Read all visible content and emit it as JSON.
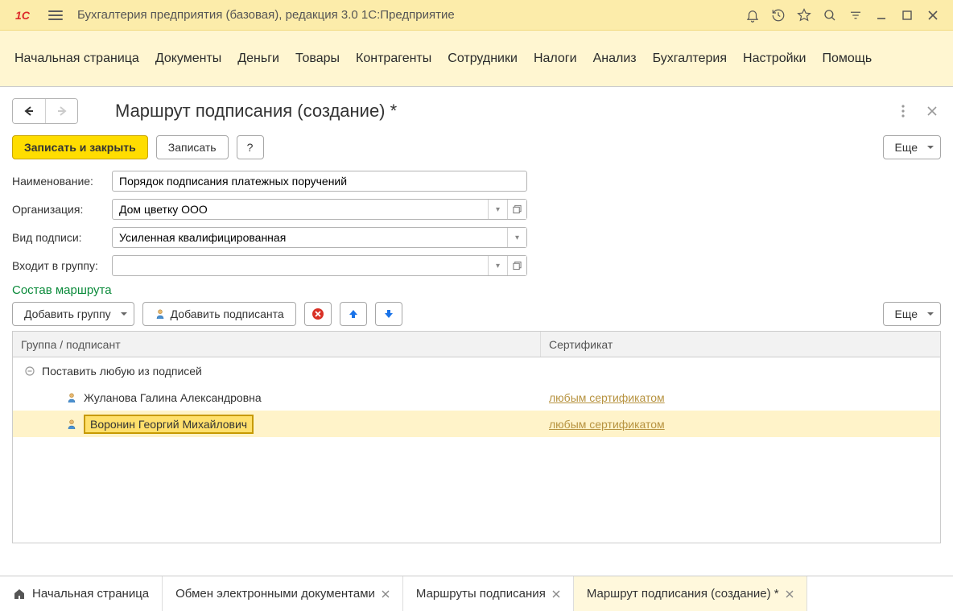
{
  "titlebar": {
    "title": "Бухгалтерия предприятия (базовая), редакция 3.0 1С:Предприятие"
  },
  "main_menu": [
    "Начальная страница",
    "Документы",
    "Деньги",
    "Товары",
    "Контрагенты",
    "Сотрудники",
    "Налоги",
    "Анализ",
    "Бухгалтерия",
    "Настройки",
    "Помощь"
  ],
  "page": {
    "title": "Маршрут подписания (создание) *"
  },
  "cmdbar": {
    "save_close": "Записать и закрыть",
    "save": "Записать",
    "help": "?",
    "more": "Еще"
  },
  "form": {
    "name_label": "Наименование:",
    "name_value": "Порядок подписания платежных поручений",
    "org_label": "Организация:",
    "org_value": "Дом цветку ООО",
    "sig_type_label": "Вид подписи:",
    "sig_type_value": "Усиленная квалифицированная",
    "group_label": "Входит в группу:",
    "group_value": ""
  },
  "route_section": {
    "title": "Состав маршрута",
    "add_group": "Добавить группу",
    "add_signer": "Добавить подписанта",
    "more": "Еще",
    "col_group": "Группа / подписант",
    "col_cert": "Сертификат",
    "rows": [
      {
        "type": "group",
        "text": "Поставить любую из подписей"
      },
      {
        "type": "signer",
        "text": "Жуланова Галина Александровна",
        "cert": "любым сертификатом",
        "selected": false
      },
      {
        "type": "signer",
        "text": "Воронин Георгий Михайлович",
        "cert": "любым сертификатом",
        "selected": true
      }
    ]
  },
  "bottom_tabs": [
    {
      "label": "Начальная страница",
      "home": true,
      "closable": false,
      "active": false
    },
    {
      "label": "Обмен электронными документами",
      "closable": true,
      "active": false
    },
    {
      "label": "Маршруты подписания",
      "closable": true,
      "active": false
    },
    {
      "label": "Маршрут подписания (создание) *",
      "closable": true,
      "active": true
    }
  ]
}
